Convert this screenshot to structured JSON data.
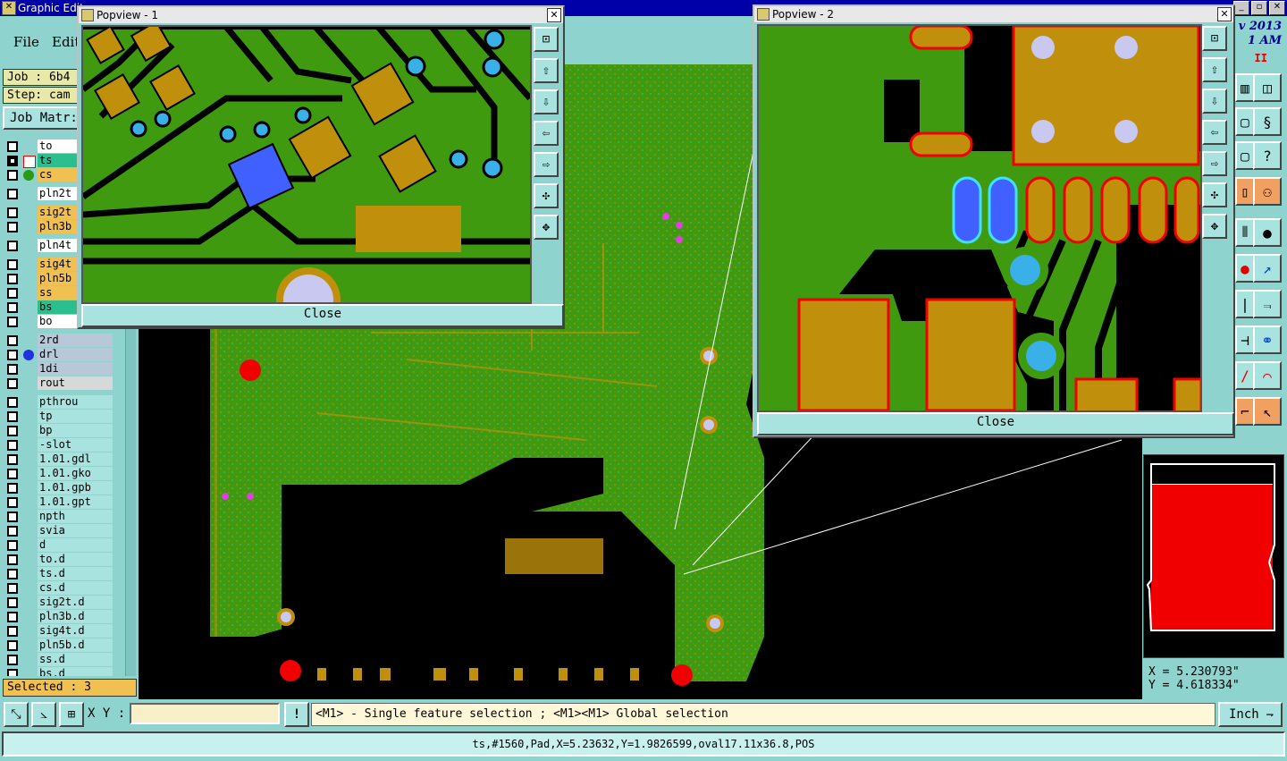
{
  "window": {
    "title": "Graphic Edit"
  },
  "menu": {
    "file": "File",
    "edit": "Edit"
  },
  "clock": {
    "line1": "v 2013",
    "line2": "1 AM",
    "pause": "II"
  },
  "job": {
    "job_label": "Job : 6b4",
    "step_label": "Step: cam",
    "matrix_label": "Job Matr:"
  },
  "layers": [
    {
      "name": "to",
      "color": "#ffffff",
      "checked": false
    },
    {
      "name": "ts",
      "color": "#2bbf8f",
      "checked": true
    },
    {
      "name": "cs",
      "color": "#f0c050",
      "checked": false
    },
    {
      "name": "pln2t",
      "color": "#ffffff",
      "checked": false
    },
    {
      "name": "sig2t",
      "color": "#f0c050",
      "checked": false
    },
    {
      "name": "pln3b",
      "color": "#f0c050",
      "checked": false
    },
    {
      "name": "pln4t",
      "color": "#ffffff",
      "checked": false
    },
    {
      "name": "sig4t",
      "color": "#f0c050",
      "checked": false
    },
    {
      "name": "pln5b",
      "color": "#f0c050",
      "checked": false
    },
    {
      "name": "ss",
      "color": "#f0c050",
      "checked": false
    },
    {
      "name": "bs",
      "color": "#2bbf8f",
      "checked": false
    },
    {
      "name": "bo",
      "color": "#ffffff",
      "checked": false
    },
    {
      "name": "2rd",
      "color": "#b8c8d8",
      "checked": false
    },
    {
      "name": "drl",
      "color": "#b8c8d8",
      "checked": false
    },
    {
      "name": "1di",
      "color": "#b8c8d8",
      "checked": false
    },
    {
      "name": "rout",
      "color": "#d8d8d8",
      "checked": false
    },
    {
      "name": "pthrou",
      "color": "#a9e3e0",
      "checked": false
    },
    {
      "name": "tp",
      "color": "#a9e3e0",
      "checked": false
    },
    {
      "name": "bp",
      "color": "#a9e3e0",
      "checked": false
    },
    {
      "name": "-slot",
      "color": "#a9e3e0",
      "checked": false
    },
    {
      "name": "1.01.gdl",
      "color": "#a9e3e0",
      "checked": false
    },
    {
      "name": "1.01.gko",
      "color": "#a9e3e0",
      "checked": false
    },
    {
      "name": "1.01.gpb",
      "color": "#a9e3e0",
      "checked": false
    },
    {
      "name": "1.01.gpt",
      "color": "#a9e3e0",
      "checked": false
    },
    {
      "name": "npth",
      "color": "#a9e3e0",
      "checked": false
    },
    {
      "name": "svia",
      "color": "#a9e3e0",
      "checked": false
    },
    {
      "name": "d",
      "color": "#a9e3e0",
      "checked": false
    },
    {
      "name": "to.d",
      "color": "#a9e3e0",
      "checked": false
    },
    {
      "name": "ts.d",
      "color": "#a9e3e0",
      "checked": false
    },
    {
      "name": "cs.d",
      "color": "#a9e3e0",
      "checked": false
    },
    {
      "name": "sig2t.d",
      "color": "#a9e3e0",
      "checked": false
    },
    {
      "name": "pln3b.d",
      "color": "#a9e3e0",
      "checked": false
    },
    {
      "name": "sig4t.d",
      "color": "#a9e3e0",
      "checked": false
    },
    {
      "name": "pln5b.d",
      "color": "#a9e3e0",
      "checked": false
    },
    {
      "name": "ss.d",
      "color": "#a9e3e0",
      "checked": false
    },
    {
      "name": "bs.d",
      "color": "#a9e3e0",
      "checked": false
    }
  ],
  "selected": "Selected : 3",
  "popup1": {
    "title": "Popview - 1",
    "close": "Close",
    "close_x": "✕"
  },
  "popup2": {
    "title": "Popview - 2",
    "close": "Close",
    "close_x": "✕"
  },
  "coords": {
    "x": "X = 5.230793\"",
    "y": "Y = 4.618334\""
  },
  "cmd": {
    "xy_label": "X Y :",
    "excl": "!",
    "prompt": "<M1> - Single feature selection ; <M1><M1> Global selection",
    "unit": "Inch"
  },
  "status": "ts,#1560,Pad,X=5.23632,Y=1.9826599,oval17.11x36.8,POS",
  "colors": {
    "board": "#3f9a10",
    "copper": "#c0900c",
    "drill": "#3ab0e8",
    "selected": "#4060ff"
  }
}
